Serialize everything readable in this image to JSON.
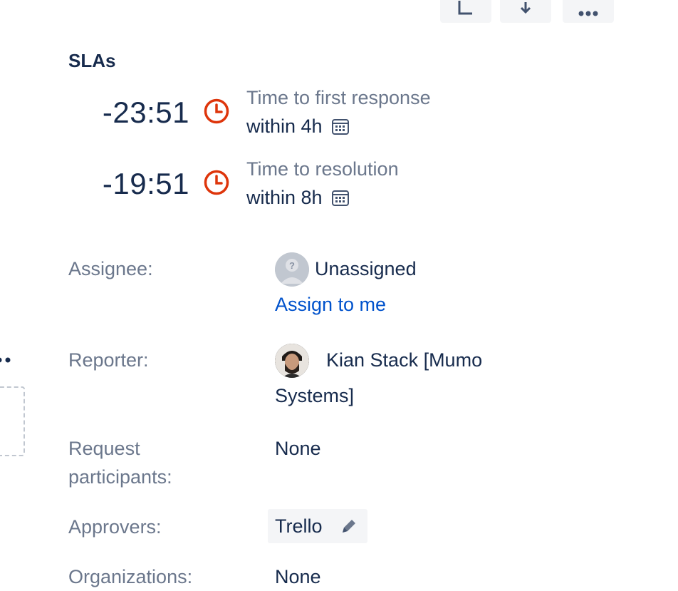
{
  "toolbar": {
    "share_icon": "share-icon",
    "transition_icon": "transition-icon",
    "more_icon": "more-icon"
  },
  "slas": {
    "title": "SLAs",
    "items": [
      {
        "remaining": "-23:51",
        "name": "Time to first response",
        "goal": "within 4h",
        "status_color": "#de350b"
      },
      {
        "remaining": "-19:51",
        "name": "Time to resolution",
        "goal": "within 8h",
        "status_color": "#de350b"
      }
    ]
  },
  "fields": {
    "assignee": {
      "label": "Assignee:",
      "value": "Unassigned",
      "action": "Assign to me"
    },
    "reporter": {
      "label": "Reporter:",
      "value_line1": "Kian Stack [Mumo",
      "value_line2": "Systems]"
    },
    "request_participants": {
      "label_line1": "Request",
      "label_line2": "participants:",
      "value": "None"
    },
    "approvers": {
      "label": "Approvers:",
      "value": "Trello"
    },
    "organizations": {
      "label": "Organizations:",
      "value": "None"
    }
  },
  "colors": {
    "text": "#172b4d",
    "subtle": "#6b778c",
    "link": "#0052cc",
    "breached": "#de350b"
  }
}
